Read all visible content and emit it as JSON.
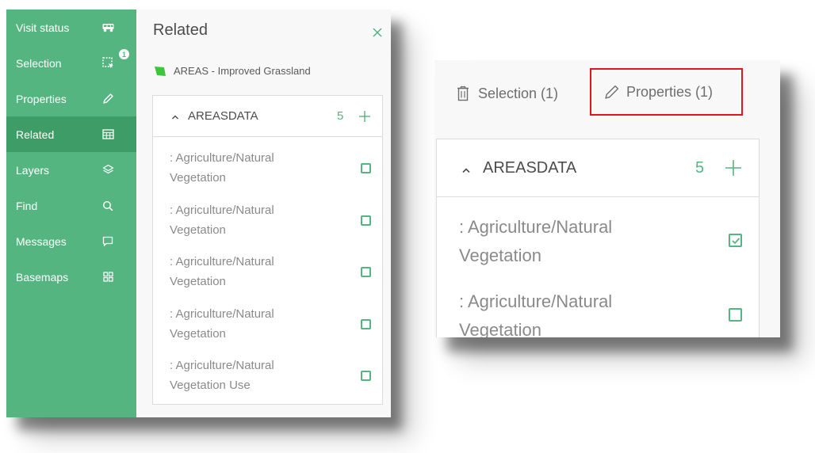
{
  "sidebar": {
    "items": [
      {
        "label": "Visit status",
        "icon": "truck-icon"
      },
      {
        "label": "Selection",
        "icon": "selection-icon",
        "badge": "1"
      },
      {
        "label": "Properties",
        "icon": "pencil-icon"
      },
      {
        "label": "Related",
        "icon": "table-icon"
      },
      {
        "label": "Layers",
        "icon": "layers-icon"
      },
      {
        "label": "Find",
        "icon": "search-icon"
      },
      {
        "label": "Messages",
        "icon": "message-icon"
      },
      {
        "label": "Basemaps",
        "icon": "grid-icon"
      }
    ],
    "active_index": 3
  },
  "related_panel": {
    "title": "Related",
    "layer_label": "AREAS - Improved Grassland",
    "section_title": "AREASDATA",
    "count": "5",
    "items": [
      {
        "line1": ": Agriculture/Natural",
        "line2": "Vegetation",
        "checked": false
      },
      {
        "line1": ": Agriculture/Natural",
        "line2": "Vegetation",
        "checked": false
      },
      {
        "line1": ": Agriculture/Natural",
        "line2": "Vegetation",
        "checked": false
      },
      {
        "line1": ": Agriculture/Natural",
        "line2": "Vegetation",
        "checked": false
      },
      {
        "line1": ": Agriculture/Natural",
        "line2": "Vegetation Use",
        "checked": false
      }
    ]
  },
  "zoom_panel": {
    "tabs": {
      "selection": "Selection (1)",
      "properties": "Properties (1)"
    },
    "section_title": "AREASDATA",
    "count": "5",
    "items": [
      {
        "line1": ": Agriculture/Natural",
        "line2": "Vegetation",
        "checked": true
      },
      {
        "line1": ": Agriculture/Natural",
        "line2": "Vegetation",
        "checked": false
      }
    ]
  },
  "colors": {
    "accent": "#54b580",
    "sidebar_active": "#3e9d67",
    "highlight_box": "#e2141d"
  }
}
